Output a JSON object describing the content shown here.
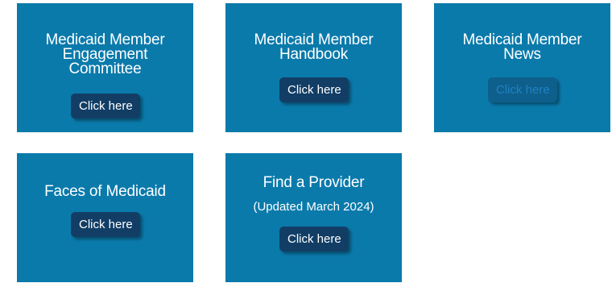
{
  "tiles": [
    {
      "title_lines": [
        "Medicaid Member",
        "Engagement",
        "Committee"
      ],
      "button_label": "Click here"
    },
    {
      "title_lines": [
        "Medicaid Member",
        "Handbook"
      ],
      "button_label": "Click here"
    },
    {
      "title_lines": [
        "Medicaid Member",
        "News"
      ],
      "button_label": "Click here"
    },
    {
      "title_lines": [
        "Faces of Medicaid"
      ],
      "button_label": "Click here"
    },
    {
      "title_lines": [
        "Find a Provider"
      ],
      "subtitle": "(Updated March 2024)",
      "button_label": "Click here"
    }
  ],
  "colors": {
    "tile_bg": "#0a7aab",
    "button_bg": "#123e66",
    "muted_button_text": "#1d82c4"
  }
}
